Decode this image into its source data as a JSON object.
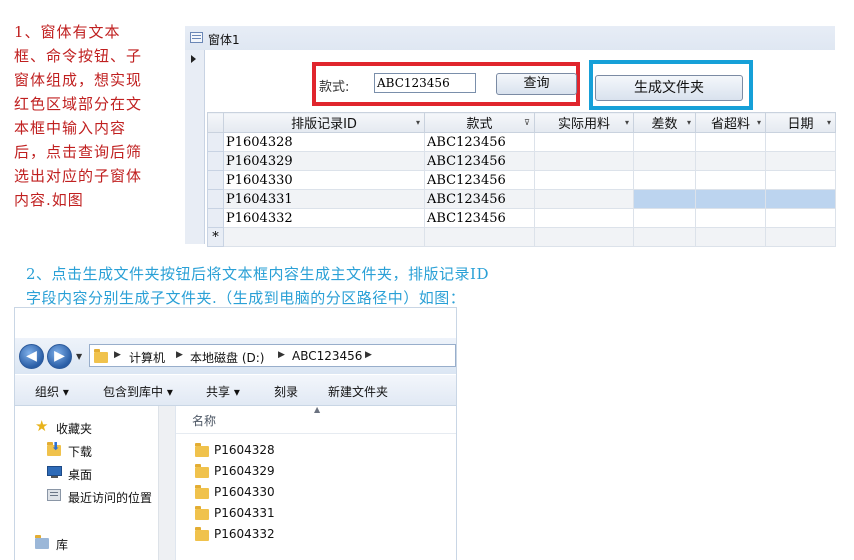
{
  "annotation1": {
    "lines": [
      "1、窗体有文本",
      "框、命令按钮、子",
      "窗体组成，想实现",
      "红色区域部分在文",
      "本框中输入内容",
      "后，点击查询后筛",
      "选出对应的子窗体",
      "内容.如图"
    ]
  },
  "access": {
    "window_title": "窗体1",
    "search": {
      "label": "款式:",
      "value": "ABC123456",
      "query_button": "查询"
    },
    "generate_button": "生成文件夹",
    "grid": {
      "columns": [
        "排版记录ID",
        "款式",
        "实际用料",
        "差数",
        "省超料",
        "日期"
      ],
      "rows": [
        [
          "P1604328",
          "ABC123456",
          "",
          "",
          "",
          ""
        ],
        [
          "P1604329",
          "ABC123456",
          "",
          "",
          "",
          ""
        ],
        [
          "P1604330",
          "ABC123456",
          "",
          "",
          "",
          ""
        ],
        [
          "P1604331",
          "ABC123456",
          "",
          "",
          "",
          ""
        ],
        [
          "P1604332",
          "ABC123456",
          "",
          "",
          "",
          ""
        ]
      ],
      "new_row_marker": "*"
    }
  },
  "annotation2": {
    "lines": [
      "2、点击生成文件夹按钮后将文本框内容生成主文件夹，排版记录ID",
      " 字段内容分别生成子文件夹.（生成到电脑的分区路径中）如图："
    ]
  },
  "explorer": {
    "breadcrumb": [
      "计算机",
      "本地磁盘 (D:)",
      "ABC123456"
    ],
    "toolbar": [
      "组织 ▾",
      "包含到库中 ▾",
      "共享 ▾",
      "刻录",
      "新建文件夹"
    ],
    "nav": {
      "favorites": "收藏夹",
      "downloads": "下载",
      "desktop": "桌面",
      "recent": "最近访问的位置",
      "libraries": "库"
    },
    "column_header": "名称",
    "folders": [
      "P1604328",
      "P1604329",
      "P1604330",
      "P1604331",
      "P1604332"
    ]
  },
  "colors": {
    "red_annotation": "#c02020",
    "blue_annotation": "#2aa0d6",
    "red_box": "#e0252d",
    "blue_box": "#16a0d8",
    "row_highlight": "#bcd4ef"
  }
}
